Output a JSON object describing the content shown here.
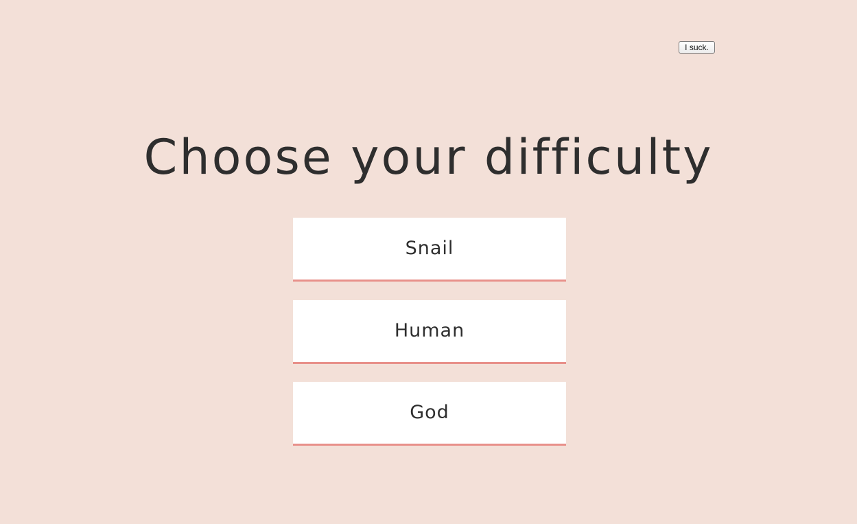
{
  "skip_button": {
    "label": "I suck."
  },
  "title": "Choose your difficulty",
  "difficulties": [
    {
      "label": "Snail"
    },
    {
      "label": "Human"
    },
    {
      "label": "God"
    }
  ],
  "colors": {
    "background": "#f3e0d8",
    "text": "#2e2e2e",
    "option_background": "#ffffff",
    "option_underline": "#e8908a"
  }
}
